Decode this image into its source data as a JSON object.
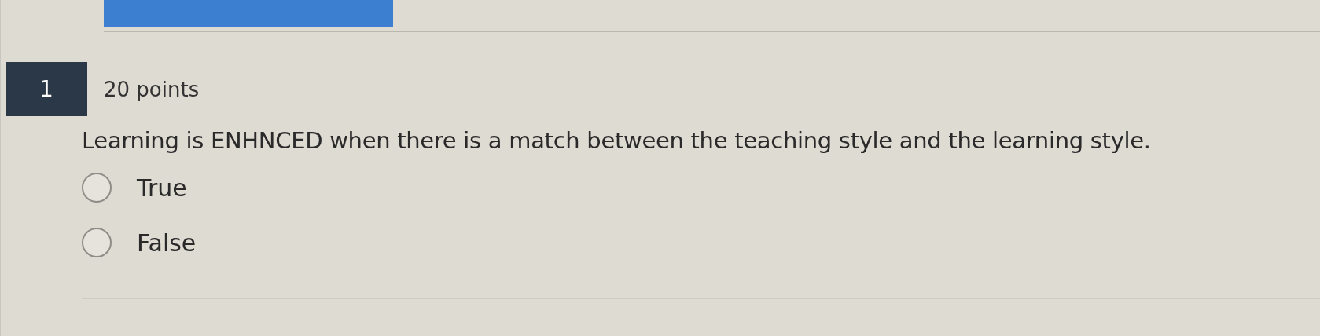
{
  "question": {
    "number": "1",
    "points": "20 points",
    "text": "Learning is ENHNCED when there is a match between the teaching style and the learning style.",
    "options": [
      {
        "label": "True",
        "selected": false
      },
      {
        "label": "False",
        "selected": false
      }
    ]
  }
}
